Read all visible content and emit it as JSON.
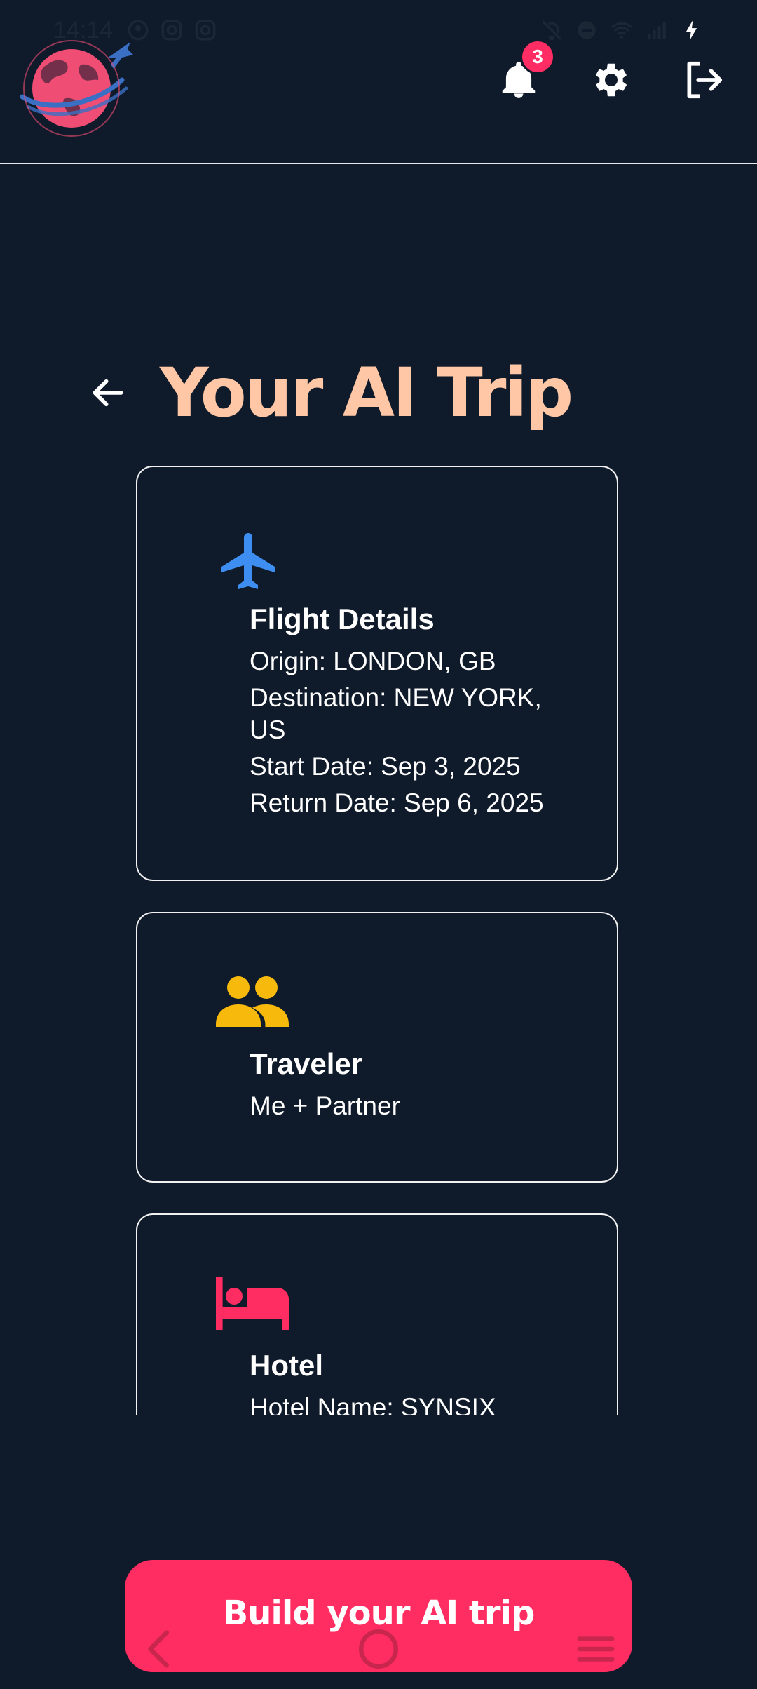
{
  "status_bar": {
    "time": "14:14",
    "left_icons": [
      "app-icon",
      "instagram-icon",
      "instagram-icon"
    ],
    "right_icons": [
      "bell-off-icon",
      "dnd-icon",
      "wifi-icon",
      "signal-icon",
      "charging-icon"
    ]
  },
  "header": {
    "logo": "globe-plane-logo",
    "notification_count": "3",
    "icons": [
      "bell-icon",
      "gear-icon",
      "logout-icon"
    ]
  },
  "page": {
    "title": "Your AI Trip",
    "back_icon": "arrow-left-icon"
  },
  "cards": {
    "flight": {
      "icon": "airplane-icon",
      "title": "Flight Details",
      "origin": "Origin: LONDON, GB",
      "destination_line1": "Destination: NEW YORK,",
      "destination_line2": "US",
      "start_date": "Start Date: Sep 3, 2025",
      "return_date": "Return Date: Sep 6, 2025"
    },
    "traveler": {
      "icon": "people-icon",
      "title": "Traveler",
      "value": "Me + Partner"
    },
    "hotel": {
      "icon": "bed-icon",
      "title": "Hotel",
      "name": "Hotel Name: SYNSIX"
    }
  },
  "cta": {
    "label": "Build your AI trip"
  },
  "colors": {
    "background": "#0f1a2a",
    "title": "#ffc7a5",
    "accent": "#ff2d62",
    "plane_blue": "#3d8ef0",
    "traveler_yellow": "#f7b90c",
    "hotel_pink": "#ff2d62"
  },
  "system_nav": [
    "back-nav-icon",
    "home-nav-icon",
    "recents-nav-icon"
  ]
}
